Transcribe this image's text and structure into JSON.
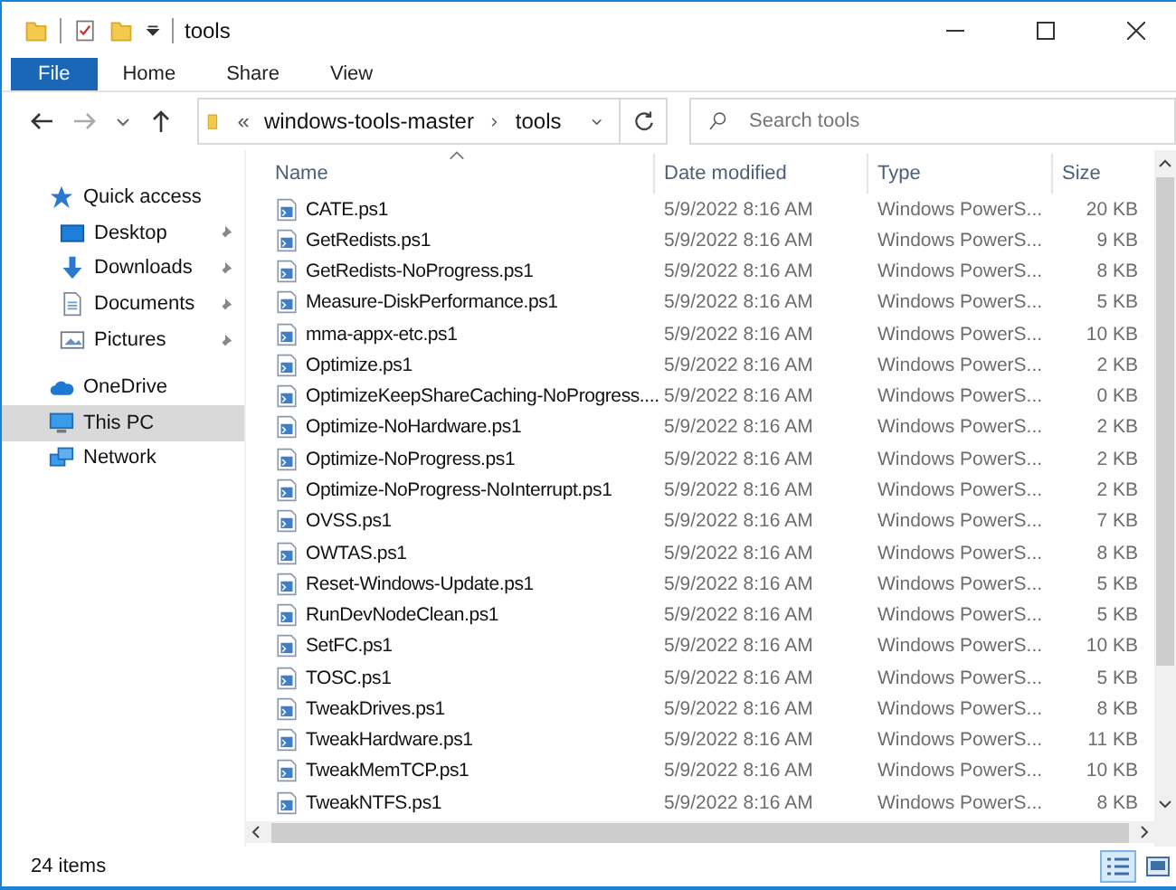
{
  "window": {
    "title": "tools"
  },
  "ribbon_tabs": [
    {
      "label": "File",
      "selected": true
    },
    {
      "label": "Home",
      "selected": false
    },
    {
      "label": "Share",
      "selected": false
    },
    {
      "label": "View",
      "selected": false
    }
  ],
  "address": {
    "overflow": "«",
    "path": [
      "windows-tools-master",
      "tools"
    ]
  },
  "search": {
    "placeholder": "Search tools"
  },
  "sidebar": {
    "items": [
      {
        "label": "Quick access",
        "kind": "star",
        "selected": false,
        "children": [
          {
            "label": "Desktop",
            "kind": "desktop",
            "pinned": true,
            "selected": false
          },
          {
            "label": "Downloads",
            "kind": "download",
            "pinned": true,
            "selected": false
          },
          {
            "label": "Documents",
            "kind": "document",
            "pinned": true,
            "selected": false
          },
          {
            "label": "Pictures",
            "kind": "picture",
            "pinned": true,
            "selected": false
          }
        ]
      },
      {
        "label": "OneDrive",
        "kind": "cloud",
        "selected": false
      },
      {
        "label": "This PC",
        "kind": "pc",
        "selected": true
      },
      {
        "label": "Network",
        "kind": "network",
        "selected": false
      }
    ]
  },
  "table": {
    "columns": [
      "Name",
      "Date modified",
      "Type",
      "Size"
    ],
    "rows": [
      {
        "name": "CATE.ps1",
        "date": "5/9/2022 8:16 AM",
        "type": "Windows PowerS...",
        "size": "20 KB"
      },
      {
        "name": "GetRedists.ps1",
        "date": "5/9/2022 8:16 AM",
        "type": "Windows PowerS...",
        "size": "9 KB"
      },
      {
        "name": "GetRedists-NoProgress.ps1",
        "date": "5/9/2022 8:16 AM",
        "type": "Windows PowerS...",
        "size": "8 KB"
      },
      {
        "name": "Measure-DiskPerformance.ps1",
        "date": "5/9/2022 8:16 AM",
        "type": "Windows PowerS...",
        "size": "5 KB"
      },
      {
        "name": "mma-appx-etc.ps1",
        "date": "5/9/2022 8:16 AM",
        "type": "Windows PowerS...",
        "size": "10 KB"
      },
      {
        "name": "Optimize.ps1",
        "date": "5/9/2022 8:16 AM",
        "type": "Windows PowerS...",
        "size": "2 KB"
      },
      {
        "name": "OptimizeKeepShareCaching-NoProgress....",
        "date": "5/9/2022 8:16 AM",
        "type": "Windows PowerS...",
        "size": "0 KB"
      },
      {
        "name": "Optimize-NoHardware.ps1",
        "date": "5/9/2022 8:16 AM",
        "type": "Windows PowerS...",
        "size": "2 KB"
      },
      {
        "name": "Optimize-NoProgress.ps1",
        "date": "5/9/2022 8:16 AM",
        "type": "Windows PowerS...",
        "size": "2 KB"
      },
      {
        "name": "Optimize-NoProgress-NoInterrupt.ps1",
        "date": "5/9/2022 8:16 AM",
        "type": "Windows PowerS...",
        "size": "2 KB"
      },
      {
        "name": "OVSS.ps1",
        "date": "5/9/2022 8:16 AM",
        "type": "Windows PowerS...",
        "size": "7 KB"
      },
      {
        "name": "OWTAS.ps1",
        "date": "5/9/2022 8:16 AM",
        "type": "Windows PowerS...",
        "size": "8 KB"
      },
      {
        "name": "Reset-Windows-Update.ps1",
        "date": "5/9/2022 8:16 AM",
        "type": "Windows PowerS...",
        "size": "5 KB"
      },
      {
        "name": "RunDevNodeClean.ps1",
        "date": "5/9/2022 8:16 AM",
        "type": "Windows PowerS...",
        "size": "5 KB"
      },
      {
        "name": "SetFC.ps1",
        "date": "5/9/2022 8:16 AM",
        "type": "Windows PowerS...",
        "size": "10 KB"
      },
      {
        "name": "TOSC.ps1",
        "date": "5/9/2022 8:16 AM",
        "type": "Windows PowerS...",
        "size": "5 KB"
      },
      {
        "name": "TweakDrives.ps1",
        "date": "5/9/2022 8:16 AM",
        "type": "Windows PowerS...",
        "size": "8 KB"
      },
      {
        "name": "TweakHardware.ps1",
        "date": "5/9/2022 8:16 AM",
        "type": "Windows PowerS...",
        "size": "11 KB"
      },
      {
        "name": "TweakMemTCP.ps1",
        "date": "5/9/2022 8:16 AM",
        "type": "Windows PowerS...",
        "size": "10 KB"
      },
      {
        "name": "TweakNTFS.ps1",
        "date": "5/9/2022 8:16 AM",
        "type": "Windows PowerS...",
        "size": "8 KB"
      }
    ]
  },
  "status_bar": {
    "count": "24 items",
    "views": [
      {
        "kind": "details",
        "selected": true
      },
      {
        "kind": "large",
        "selected": false
      }
    ]
  }
}
